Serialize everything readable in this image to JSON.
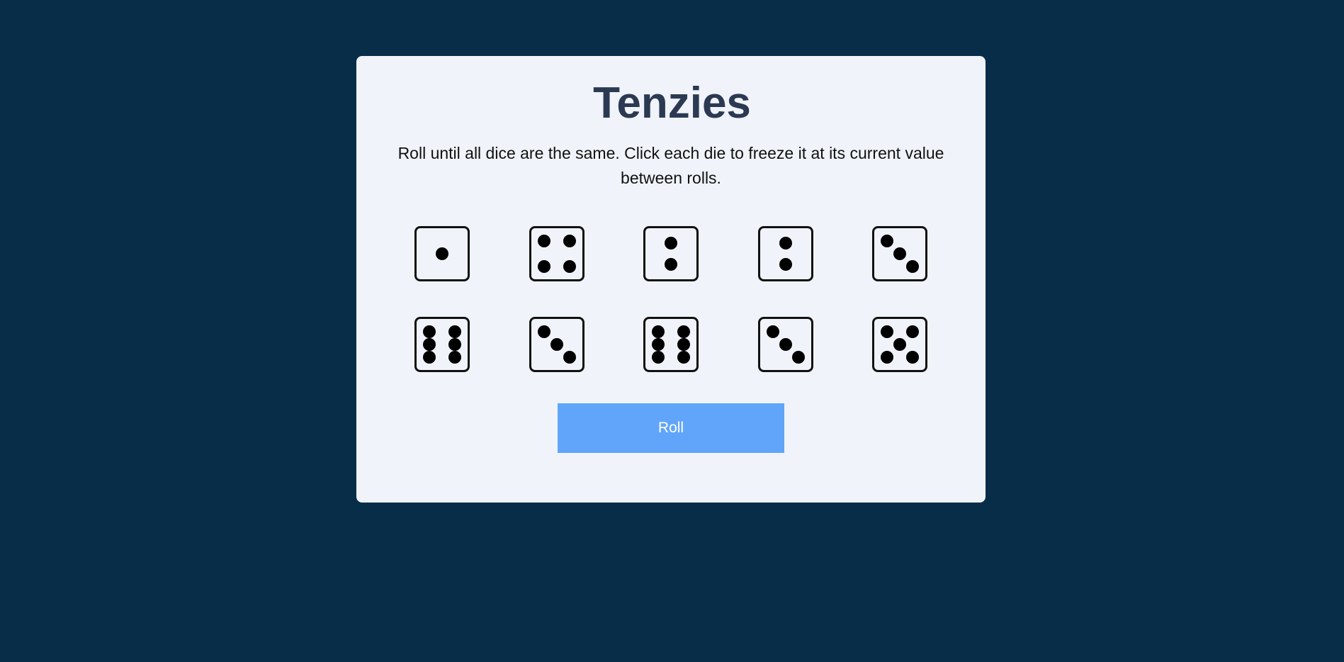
{
  "game": {
    "title": "Tenzies",
    "instructions": "Roll until all dice are the same. Click each die to freeze it at its current value between rolls.",
    "dice": [
      1,
      4,
      2,
      2,
      3,
      6,
      3,
      6,
      3,
      5
    ],
    "roll_label": "Roll"
  },
  "colors": {
    "background": "#082d49",
    "card": "#f0f4fa",
    "title": "#2b3a52",
    "button": "#60a5fa",
    "button_text": "#ffffff",
    "pip": "#000000"
  }
}
